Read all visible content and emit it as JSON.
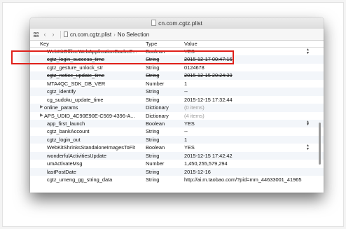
{
  "window": {
    "title": "cn.com.cgtz.plist"
  },
  "toolbar": {
    "file": "cn.com.cgtz.plist",
    "selection": "No Selection"
  },
  "columns": {
    "key": "Key",
    "type": "Type",
    "value": "Value"
  },
  "rows": [
    {
      "key": "WebKitOfflineWebApplicationCacheE...",
      "type": "Boolean",
      "value": "YES",
      "stepper": true
    },
    {
      "key": "cgtz_login_success_time",
      "type": "String",
      "value": "2015-12-17 00:47:16",
      "strike": true
    },
    {
      "key": "cgtz_gesture_unlock_str",
      "type": "String",
      "value": "0124678"
    },
    {
      "key": "cgtz_notice_update_time",
      "type": "String",
      "value": "2015-12-15 20:24:39",
      "strike": true
    },
    {
      "key": "MTA4QC_SDK_DB_VER",
      "type": "Number",
      "value": "1"
    },
    {
      "key": "cgtz_identify",
      "type": "String",
      "value": "--"
    },
    {
      "key": "cg_sudoku_update_time",
      "type": "String",
      "value": "2015-12-15 17:32:44"
    },
    {
      "key": "online_params",
      "type": "Dictionary",
      "value": "(0 items)",
      "disclosure": true,
      "dim": true
    },
    {
      "key": "APS_UDID_4C90E90E-C569-4396-A...",
      "type": "Dictionary",
      "value": "(4 items)",
      "disclosure": true,
      "dim": true
    },
    {
      "key": "app_first_launch",
      "type": "Boolean",
      "value": "YES",
      "stepper": true
    },
    {
      "key": "cgtz_bankAccount",
      "type": "String",
      "value": "--"
    },
    {
      "key": "cgtz_login_out",
      "type": "String",
      "value": "1"
    },
    {
      "key": "WebKitShrinksStandaloneImagesToFit",
      "type": "Boolean",
      "value": "YES",
      "stepper": true
    },
    {
      "key": "wonderfulActivitiesUpdate",
      "type": "String",
      "value": "2015-12-15 17:42:42"
    },
    {
      "key": "umActivateMsg",
      "type": "Number",
      "value": "1,450,255,579,294"
    },
    {
      "key": "lastPostDate",
      "type": "String",
      "value": "2015-12-16"
    },
    {
      "key": "cgtz_umeng_gg_string_data",
      "type": "String",
      "value": "http://ai.m.taobao.com/?pid=mm_44633001_41965"
    }
  ],
  "colors": {
    "highlight": "#e0201a",
    "row_alt": "#f3f6fa"
  }
}
